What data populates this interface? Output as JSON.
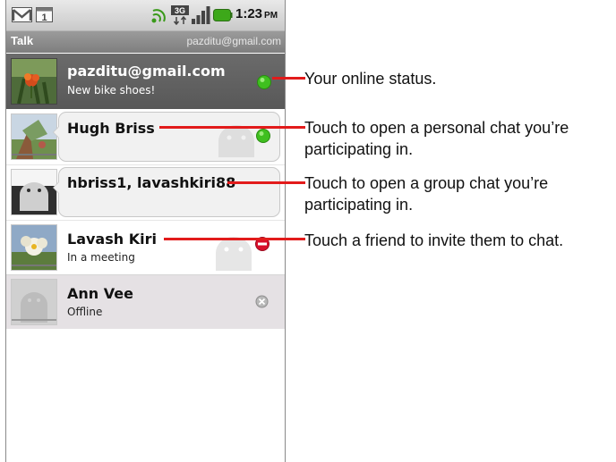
{
  "status_bar": {
    "time": "1:23",
    "ampm": "PM",
    "icons": [
      "gmail-icon",
      "calendar-icon",
      "sync-icon",
      "data-3g-icon",
      "signal-icon",
      "battery-icon"
    ],
    "data_label": "3G"
  },
  "title_bar": {
    "app": "Talk",
    "account": "pazditu@gmail.com"
  },
  "self": {
    "name": "pazditu@gmail.com",
    "status_message": "New bike shoes!",
    "presence": "available"
  },
  "chats": [
    {
      "name": "Hugh Briss",
      "type": "personal",
      "presence": "available"
    },
    {
      "name": "hbriss1, lavashkiri88",
      "type": "group"
    }
  ],
  "friends": [
    {
      "name": "Lavash Kiri",
      "status_message": "In a meeting",
      "presence": "busy"
    },
    {
      "name": "Ann Vee",
      "status_message": "Offline",
      "presence": "offline"
    }
  ],
  "colors": {
    "available": "#3fbf1f",
    "busy": "#d8102c",
    "offline": "#9a9a9a",
    "callout_line": "#e21b1b"
  },
  "callouts": [
    "Your online status.",
    "Touch to open a personal chat you’re participating in.",
    "Touch to open a group chat you’re participating in.",
    "Touch a friend to invite them to chat."
  ]
}
